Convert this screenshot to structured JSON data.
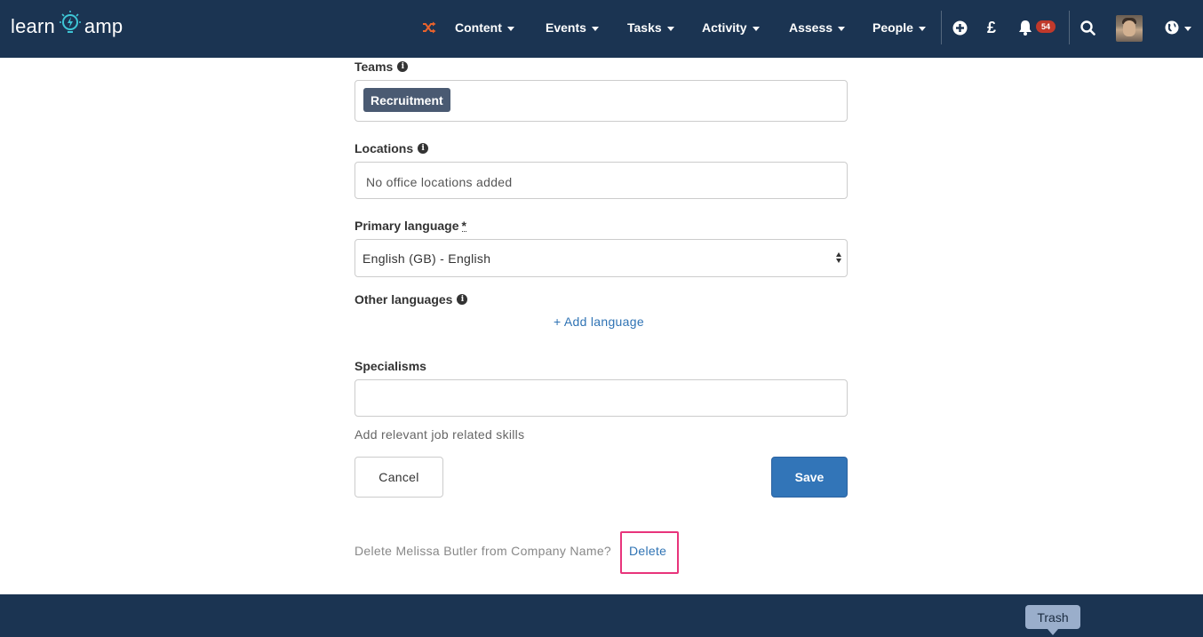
{
  "app": {
    "logo_left": "learn",
    "logo_right": "amp"
  },
  "nav": {
    "items": [
      {
        "label": "Content"
      },
      {
        "label": "Events"
      },
      {
        "label": "Tasks"
      },
      {
        "label": "Activity"
      },
      {
        "label": "Assess"
      },
      {
        "label": "People"
      }
    ],
    "currency_symbol": "£",
    "notification_count": "54",
    "icons": [
      "shuffle-icon",
      "add-circle-icon",
      "pound-icon",
      "bell-icon",
      "search-icon",
      "avatar",
      "globe-icon"
    ]
  },
  "form": {
    "teams": {
      "label": "Teams",
      "tags": [
        "Recruitment"
      ]
    },
    "locations": {
      "label": "Locations",
      "empty_text": "No office locations added"
    },
    "primary_language": {
      "label": "Primary language",
      "required_mark": "*",
      "value": "English (GB) - English"
    },
    "other_languages": {
      "label": "Other languages",
      "add_link": "+ Add language"
    },
    "specialisms": {
      "label": "Specialisms",
      "value": "",
      "help": "Add relevant job related skills"
    },
    "cancel_label": "Cancel",
    "save_label": "Save"
  },
  "delete_section": {
    "prompt": "Delete Melissa Butler from Company Name?",
    "link": "Delete"
  },
  "tooltip": {
    "text": "Trash"
  },
  "colors": {
    "navbar_bg": "#1b3452",
    "accent_orange": "#e8622c",
    "link_blue": "#2f73b4",
    "save_button": "#3275b8",
    "highlight_pink": "#e8347b",
    "badge_red": "#c0392b",
    "tag_bg": "#4a5a72"
  }
}
